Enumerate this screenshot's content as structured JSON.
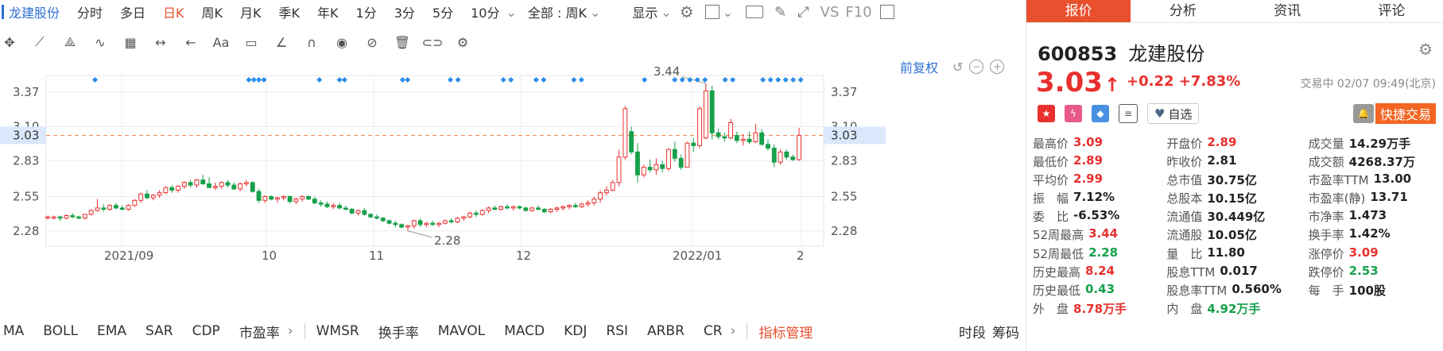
{
  "stock": {
    "name": "龙建股份",
    "code": "600853"
  },
  "periods": [
    "分时",
    "多日",
    "日K",
    "周K",
    "月K",
    "季K",
    "年K",
    "1分",
    "3分",
    "5分",
    "10分"
  ],
  "period_active": "日K",
  "cycle_selector": "全部 : 周K",
  "display_label": "显示",
  "vs_label": "VS",
  "f10_label": "F10",
  "adj_label": "前复权",
  "indicators": [
    "MA",
    "BOLL",
    "EMA",
    "SAR",
    "CDP",
    "市盈率",
    "WMSR",
    "换手率",
    "MAVOL",
    "MACD",
    "KDJ",
    "RSI",
    "ARBR",
    "CR"
  ],
  "indicator_manage": "指标管理",
  "bottom_right": [
    "时段",
    "筹码"
  ],
  "chart_data": {
    "type": "candlestick",
    "y_ticks": [
      3.37,
      3.1,
      2.83,
      2.55,
      2.28
    ],
    "y_tick_labels": [
      "3.37",
      "3.10",
      "2.83",
      "2.55",
      "2.28"
    ],
    "ylim": [
      2.16,
      3.47
    ],
    "x_labels": [
      "2021/09",
      "10",
      "11",
      "12",
      "2022/01",
      "2"
    ],
    "current_price": "3.03",
    "high_label": "3.44",
    "low_label": "2.28",
    "candles": [
      [
        2.39,
        2.4,
        2.37,
        2.39
      ],
      [
        2.38,
        2.4,
        2.37,
        2.39
      ],
      [
        2.39,
        2.4,
        2.36,
        2.38
      ],
      [
        2.38,
        2.41,
        2.37,
        2.4
      ],
      [
        2.4,
        2.42,
        2.38,
        2.39
      ],
      [
        2.39,
        2.4,
        2.37,
        2.38
      ],
      [
        2.38,
        2.41,
        2.37,
        2.41
      ],
      [
        2.41,
        2.45,
        2.4,
        2.44
      ],
      [
        2.44,
        2.53,
        2.43,
        2.46
      ],
      [
        2.46,
        2.49,
        2.43,
        2.45
      ],
      [
        2.45,
        2.49,
        2.44,
        2.48
      ],
      [
        2.48,
        2.5,
        2.45,
        2.46
      ],
      [
        2.46,
        2.48,
        2.44,
        2.45
      ],
      [
        2.45,
        2.49,
        2.44,
        2.48
      ],
      [
        2.48,
        2.53,
        2.47,
        2.52
      ],
      [
        2.52,
        2.58,
        2.5,
        2.57
      ],
      [
        2.57,
        2.6,
        2.53,
        2.54
      ],
      [
        2.54,
        2.57,
        2.52,
        2.56
      ],
      [
        2.56,
        2.6,
        2.54,
        2.58
      ],
      [
        2.58,
        2.63,
        2.57,
        2.62
      ],
      [
        2.62,
        2.64,
        2.58,
        2.6
      ],
      [
        2.6,
        2.64,
        2.58,
        2.63
      ],
      [
        2.63,
        2.67,
        2.61,
        2.66
      ],
      [
        2.66,
        2.68,
        2.62,
        2.64
      ],
      [
        2.64,
        2.69,
        2.62,
        2.68
      ],
      [
        2.68,
        2.72,
        2.64,
        2.65
      ],
      [
        2.65,
        2.7,
        2.63,
        2.62
      ],
      [
        2.62,
        2.66,
        2.6,
        2.63
      ],
      [
        2.63,
        2.67,
        2.61,
        2.66
      ],
      [
        2.66,
        2.68,
        2.62,
        2.64
      ],
      [
        2.64,
        2.66,
        2.6,
        2.61
      ],
      [
        2.61,
        2.66,
        2.59,
        2.65
      ],
      [
        2.65,
        2.68,
        2.63,
        2.66
      ],
      [
        2.66,
        2.67,
        2.58,
        2.59
      ],
      [
        2.59,
        2.61,
        2.5,
        2.52
      ],
      [
        2.52,
        2.56,
        2.5,
        2.55
      ],
      [
        2.55,
        2.56,
        2.52,
        2.53
      ],
      [
        2.53,
        2.55,
        2.5,
        2.54
      ],
      [
        2.54,
        2.56,
        2.52,
        2.55
      ],
      [
        2.55,
        2.56,
        2.5,
        2.51
      ],
      [
        2.51,
        2.54,
        2.49,
        2.53
      ],
      [
        2.53,
        2.56,
        2.51,
        2.55
      ],
      [
        2.55,
        2.56,
        2.52,
        2.53
      ],
      [
        2.53,
        2.55,
        2.49,
        2.5
      ],
      [
        2.5,
        2.52,
        2.47,
        2.49
      ],
      [
        2.49,
        2.51,
        2.46,
        2.47
      ],
      [
        2.47,
        2.5,
        2.45,
        2.48
      ],
      [
        2.48,
        2.5,
        2.45,
        2.46
      ],
      [
        2.46,
        2.48,
        2.44,
        2.45
      ],
      [
        2.45,
        2.46,
        2.41,
        2.42
      ],
      [
        2.42,
        2.45,
        2.4,
        2.44
      ],
      [
        2.44,
        2.46,
        2.4,
        2.41
      ],
      [
        2.41,
        2.42,
        2.38,
        2.39
      ],
      [
        2.39,
        2.41,
        2.37,
        2.38
      ],
      [
        2.38,
        2.39,
        2.35,
        2.36
      ],
      [
        2.36,
        2.37,
        2.33,
        2.34
      ],
      [
        2.34,
        2.36,
        2.31,
        2.33
      ],
      [
        2.33,
        2.34,
        2.3,
        2.31
      ],
      [
        2.31,
        2.33,
        2.28,
        2.32
      ],
      [
        2.32,
        2.37,
        2.3,
        2.36
      ],
      [
        2.36,
        2.38,
        2.31,
        2.33
      ],
      [
        2.33,
        2.35,
        2.31,
        2.34
      ],
      [
        2.34,
        2.36,
        2.32,
        2.33
      ],
      [
        2.33,
        2.35,
        2.31,
        2.34
      ],
      [
        2.34,
        2.37,
        2.33,
        2.36
      ],
      [
        2.36,
        2.38,
        2.34,
        2.35
      ],
      [
        2.35,
        2.39,
        2.34,
        2.38
      ],
      [
        2.38,
        2.4,
        2.36,
        2.39
      ],
      [
        2.39,
        2.43,
        2.38,
        2.42
      ],
      [
        2.42,
        2.44,
        2.39,
        2.41
      ],
      [
        2.41,
        2.45,
        2.4,
        2.44
      ],
      [
        2.44,
        2.47,
        2.42,
        2.46
      ],
      [
        2.46,
        2.48,
        2.44,
        2.45
      ],
      [
        2.45,
        2.48,
        2.44,
        2.47
      ],
      [
        2.47,
        2.49,
        2.45,
        2.46
      ],
      [
        2.46,
        2.48,
        2.44,
        2.47
      ],
      [
        2.47,
        2.48,
        2.45,
        2.46
      ],
      [
        2.46,
        2.47,
        2.43,
        2.44
      ],
      [
        2.44,
        2.47,
        2.43,
        2.46
      ],
      [
        2.46,
        2.48,
        2.44,
        2.45
      ],
      [
        2.45,
        2.46,
        2.42,
        2.43
      ],
      [
        2.43,
        2.46,
        2.42,
        2.45
      ],
      [
        2.45,
        2.47,
        2.43,
        2.46
      ],
      [
        2.46,
        2.48,
        2.44,
        2.47
      ],
      [
        2.47,
        2.49,
        2.45,
        2.48
      ],
      [
        2.48,
        2.5,
        2.46,
        2.47
      ],
      [
        2.47,
        2.5,
        2.46,
        2.49
      ],
      [
        2.49,
        2.52,
        2.47,
        2.5
      ],
      [
        2.5,
        2.55,
        2.48,
        2.53
      ],
      [
        2.53,
        2.6,
        2.5,
        2.58
      ],
      [
        2.58,
        2.63,
        2.56,
        2.6
      ],
      [
        2.6,
        2.68,
        2.59,
        2.66
      ],
      [
        2.66,
        2.92,
        2.63,
        2.86
      ],
      [
        2.86,
        3.26,
        2.84,
        3.24
      ],
      [
        3.06,
        3.1,
        2.88,
        2.9
      ],
      [
        2.9,
        2.97,
        2.66,
        2.72
      ],
      [
        2.72,
        2.8,
        2.7,
        2.78
      ],
      [
        2.78,
        2.84,
        2.74,
        2.76
      ],
      [
        2.76,
        2.85,
        2.72,
        2.8
      ],
      [
        2.8,
        2.83,
        2.74,
        2.77
      ],
      [
        2.77,
        2.93,
        2.75,
        2.92
      ],
      [
        2.92,
        2.98,
        2.82,
        2.85
      ],
      [
        2.85,
        2.88,
        2.76,
        2.78
      ],
      [
        2.78,
        2.98,
        2.78,
        2.97
      ],
      [
        2.97,
        3.01,
        2.9,
        2.95
      ],
      [
        2.95,
        3.26,
        2.93,
        3.24
      ],
      [
        3.01,
        3.44,
        3.0,
        3.38
      ],
      [
        3.38,
        3.42,
        3.0,
        3.05
      ],
      [
        3.05,
        3.08,
        3.0,
        3.02
      ],
      [
        3.02,
        3.05,
        2.98,
        3.01
      ],
      [
        3.01,
        3.16,
        3.0,
        3.13
      ],
      [
        3.03,
        3.06,
        2.97,
        2.99
      ],
      [
        2.99,
        3.04,
        2.95,
        3.0
      ],
      [
        3.0,
        3.06,
        2.96,
        2.98
      ],
      [
        2.98,
        3.12,
        2.97,
        3.05
      ],
      [
        3.05,
        3.08,
        2.95,
        2.96
      ],
      [
        2.96,
        3.0,
        2.91,
        2.93
      ],
      [
        2.93,
        2.96,
        2.78,
        2.82
      ],
      [
        2.82,
        2.92,
        2.8,
        2.9
      ],
      [
        2.9,
        2.92,
        2.84,
        2.86
      ],
      [
        2.86,
        2.88,
        2.83,
        2.84
      ],
      [
        2.84,
        3.09,
        2.83,
        3.03
      ]
    ],
    "markers_count": 30
  },
  "quote": {
    "code": "600853",
    "name": "龙建股份",
    "price": "3.03",
    "arrow": "↑",
    "change": "+0.22",
    "change_pct": "+7.83%",
    "time": "交易中 02/07 09:49(北京)",
    "watch_label": "自选",
    "trade_label": "快捷交易",
    "fields": [
      [
        {
          "l": "最高价",
          "v": "3.09",
          "c": "red"
        },
        {
          "l": "开盘价",
          "v": "2.89",
          "c": "red"
        },
        {
          "l": "成交量",
          "v": "14.29万手",
          "c": ""
        }
      ],
      [
        {
          "l": "最低价",
          "v": "2.89",
          "c": "red"
        },
        {
          "l": "昨收价",
          "v": "2.81",
          "c": ""
        },
        {
          "l": "成交额",
          "v": "4268.37万",
          "c": ""
        }
      ],
      [
        {
          "l": "平均价",
          "v": "2.99",
          "c": "red"
        },
        {
          "l": "总市值",
          "v": "30.75亿",
          "c": ""
        },
        {
          "l": "市盈率TTM",
          "v": "13.00",
          "c": ""
        }
      ],
      [
        {
          "l": "振　幅",
          "v": "7.12%",
          "c": ""
        },
        {
          "l": "总股本",
          "v": "10.15亿",
          "c": ""
        },
        {
          "l": "市盈率(静)",
          "v": "13.71",
          "c": ""
        }
      ],
      [
        {
          "l": "委　比",
          "v": "-6.53%",
          "c": ""
        },
        {
          "l": "流通值",
          "v": "30.449亿",
          "c": ""
        },
        {
          "l": "市净率",
          "v": "1.473",
          "c": ""
        }
      ],
      [
        {
          "l": "52周最高",
          "v": "3.44",
          "c": "red"
        },
        {
          "l": "流通股",
          "v": "10.05亿",
          "c": ""
        },
        {
          "l": "换手率",
          "v": "1.42%",
          "c": ""
        }
      ],
      [
        {
          "l": "52周最低",
          "v": "2.28",
          "c": "grn"
        },
        {
          "l": "量　比",
          "v": "11.80",
          "c": ""
        },
        {
          "l": "涨停价",
          "v": "3.09",
          "c": "red"
        }
      ],
      [
        {
          "l": "历史最高",
          "v": "8.24",
          "c": "red"
        },
        {
          "l": "股息TTM",
          "v": "0.017",
          "c": ""
        },
        {
          "l": "跌停价",
          "v": "2.53",
          "c": "grn"
        }
      ],
      [
        {
          "l": "历史最低",
          "v": "0.43",
          "c": "grn"
        },
        {
          "l": "股息率TTM",
          "v": "0.560%",
          "c": ""
        },
        {
          "l": "每　手",
          "v": "100股",
          "c": ""
        }
      ],
      [
        {
          "l": "外　盘",
          "v": "8.78万手",
          "c": "red"
        },
        {
          "l": "内　盘",
          "v": "4.92万手",
          "c": "grn"
        },
        {
          "l": "",
          "v": "",
          "c": ""
        }
      ]
    ]
  },
  "right_tabs": [
    "报价",
    "分析",
    "资讯",
    "评论"
  ],
  "colors": {
    "up": "#e8302e",
    "down": "#16a04a",
    "accent": "#e8502e",
    "marker": "#2b8ce8"
  }
}
